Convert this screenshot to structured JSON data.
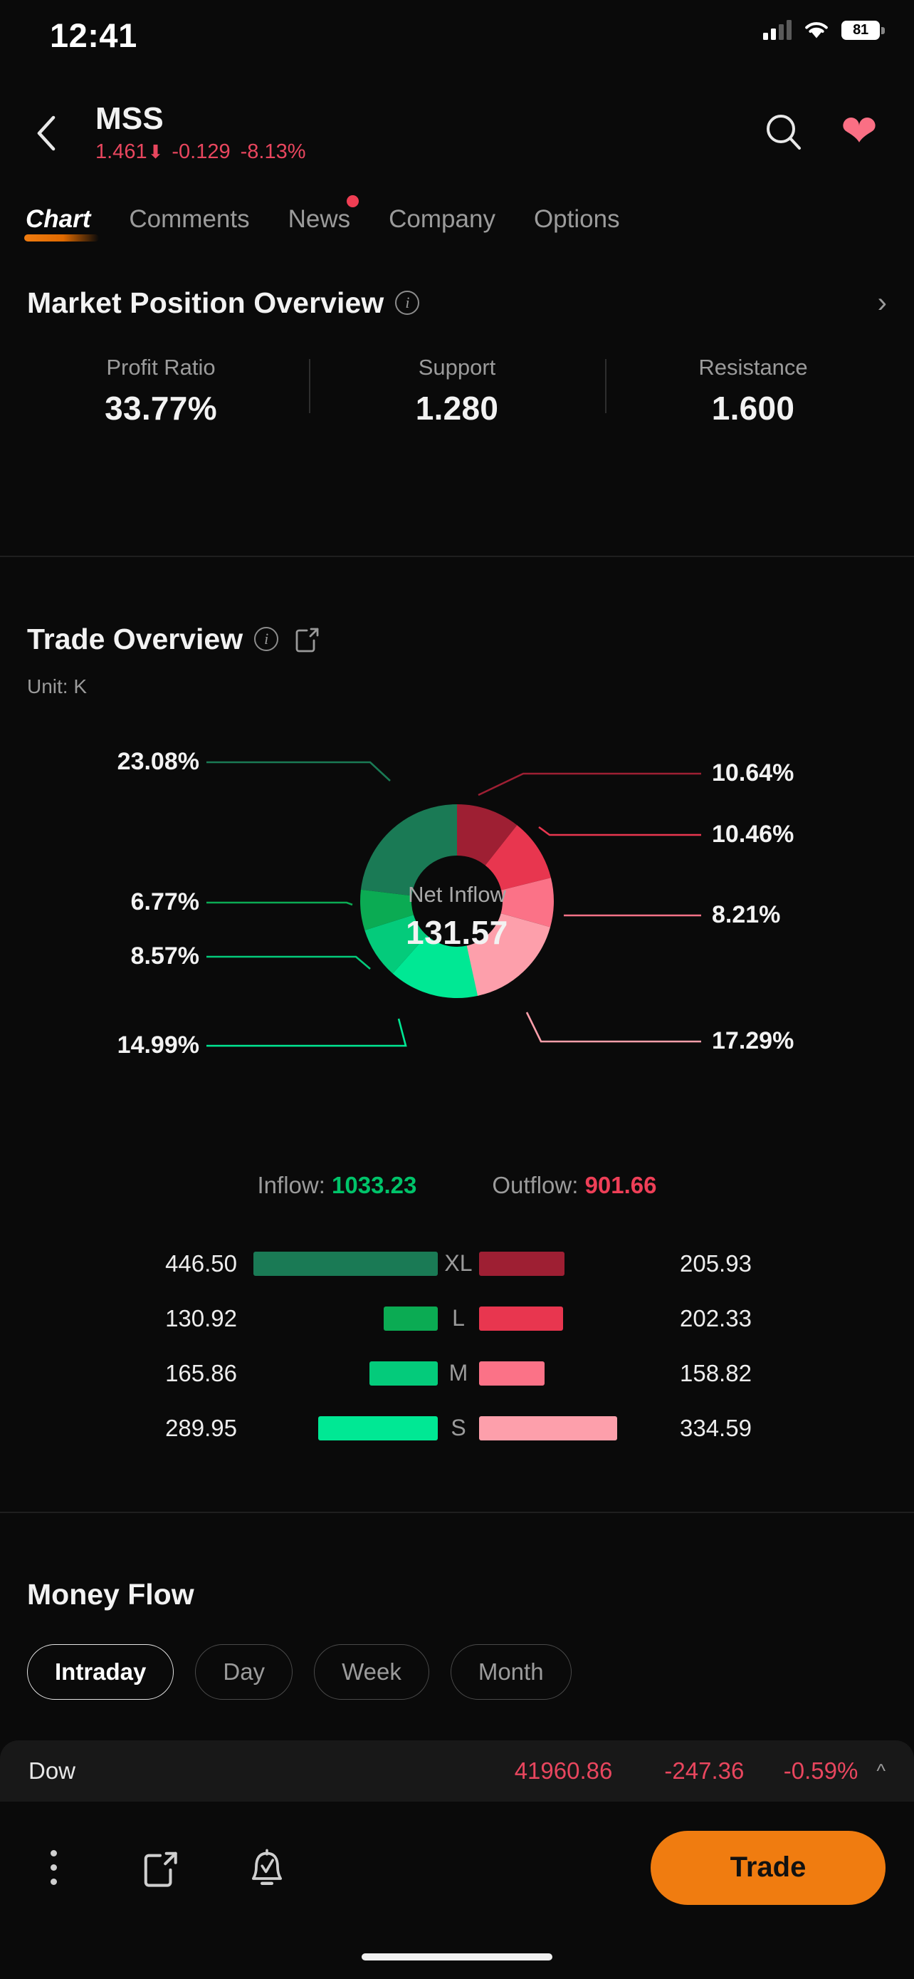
{
  "status_bar": {
    "time": "12:41",
    "battery": "81",
    "signal_icon": "cellular-signal-icon",
    "wifi_icon": "wifi-icon",
    "battery_icon": "battery-icon"
  },
  "header": {
    "back_icon": "back-chevron-icon",
    "symbol": "MSS",
    "price": "1.461",
    "arrow": "⬇",
    "change": "-0.129",
    "change_pct": "-8.13%",
    "search_icon": "search-icon",
    "favorite_icon": "heart-icon"
  },
  "tabs": [
    {
      "label": "Chart",
      "active": true,
      "badge": false
    },
    {
      "label": "Comments",
      "active": false,
      "badge": false
    },
    {
      "label": "News",
      "active": false,
      "badge": true
    },
    {
      "label": "Company",
      "active": false,
      "badge": false
    },
    {
      "label": "Options",
      "active": false,
      "badge": false
    }
  ],
  "market_position": {
    "title": "Market Position Overview",
    "info_icon": "info-icon",
    "chevron_icon": "chevron-right-icon",
    "stats": [
      {
        "label": "Profit Ratio",
        "value": "33.77%"
      },
      {
        "label": "Support",
        "value": "1.280"
      },
      {
        "label": "Resistance",
        "value": "1.600"
      }
    ]
  },
  "trade_overview": {
    "title": "Trade Overview",
    "info_icon": "info-icon",
    "share_icon": "share-icon",
    "unit": "Unit: K",
    "center_label": "Net Inflow",
    "center_value": "131.57",
    "inflow_label": "Inflow:",
    "inflow_value": "1033.23",
    "outflow_label": "Outflow:",
    "outflow_value": "901.66"
  },
  "money_flow": {
    "title": "Money Flow",
    "ranges": [
      {
        "label": "Intraday",
        "active": true
      },
      {
        "label": "Day",
        "active": false
      },
      {
        "label": "Week",
        "active": false
      },
      {
        "label": "Month",
        "active": false
      }
    ]
  },
  "ticker_strip": {
    "name": "Dow",
    "value": "41960.86",
    "change": "-247.36",
    "change_pct": "-0.59%",
    "expand_icon": "chevron-up-icon"
  },
  "bottom_bar": {
    "more_icon": "kebab-menu-icon",
    "share_icon": "share-icon",
    "alert_icon": "bell-check-icon",
    "trade_label": "Trade"
  },
  "colors": {
    "accent": "#f07c10",
    "up": "#00c46a",
    "down": "#ee3f57",
    "background": "#0a0a0a",
    "inflow_xl": "#1a7a55",
    "inflow_l": "#0bab53",
    "inflow_m": "#04cb7b",
    "inflow_s": "#00e894",
    "outflow_xl": "#9e1f33",
    "outflow_l": "#e8364f",
    "outflow_m": "#fb7287",
    "outflow_s": "#fd9fab"
  },
  "chart_data": [
    {
      "type": "pie",
      "title": "Trade Overview",
      "subtitle": "Unit: K",
      "center_label": "Net Inflow",
      "center_value": 131.57,
      "legend": "none",
      "categories": [
        "XL Outflow",
        "L Outflow",
        "M Outflow",
        "S Outflow",
        "S Inflow",
        "M Inflow",
        "L Inflow",
        "XL Inflow"
      ],
      "values": [
        10.64,
        10.46,
        8.21,
        17.29,
        14.99,
        8.57,
        6.77,
        23.08
      ],
      "labels": [
        "10.64%",
        "10.46%",
        "8.21%",
        "17.29%",
        "14.99%",
        "8.57%",
        "6.77%",
        "23.08%"
      ],
      "colors": [
        "#9e1f33",
        "#e8364f",
        "#fb7287",
        "#fd9fab",
        "#00e894",
        "#04cb7b",
        "#0bab53",
        "#1a7a55"
      ],
      "side": [
        "right",
        "right",
        "right",
        "right",
        "left",
        "left",
        "left",
        "left"
      ]
    },
    {
      "type": "bar",
      "title": "Inflow vs Outflow by order size",
      "orientation": "horizontal-diverging",
      "categories": [
        "XL",
        "L",
        "M",
        "S"
      ],
      "xlabel": "",
      "ylabel": "",
      "series": [
        {
          "name": "Inflow",
          "values": [
            446.5,
            130.92,
            165.86,
            289.95
          ],
          "labels": [
            "446.50",
            "130.92",
            "165.86",
            "289.95"
          ],
          "colors": [
            "#1a7a55",
            "#0bab53",
            "#04cb7b",
            "#00e894"
          ],
          "total_label": "Inflow:",
          "total": 1033.23
        },
        {
          "name": "Outflow",
          "values": [
            205.93,
            202.33,
            158.82,
            334.59
          ],
          "labels": [
            "205.93",
            "202.33",
            "158.82",
            "334.59"
          ],
          "colors": [
            "#9e1f33",
            "#e8364f",
            "#fb7287",
            "#fd9fab"
          ],
          "total_label": "Outflow:",
          "total": 901.66
        }
      ],
      "max_value": 446.5
    }
  ]
}
